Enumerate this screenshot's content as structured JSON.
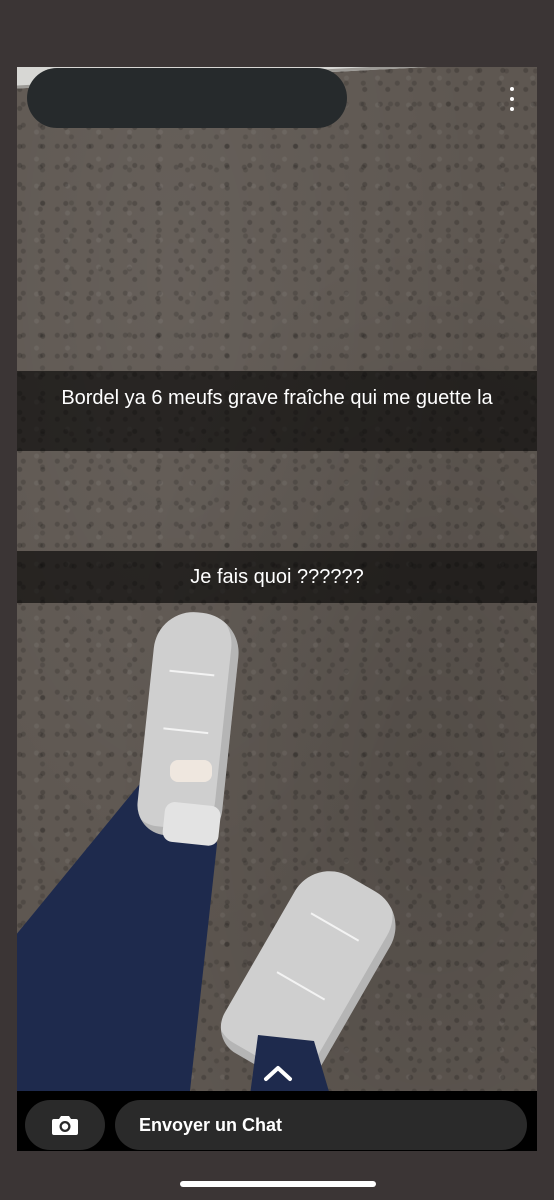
{
  "snap": {
    "captions": [
      "Bordel ya 6 meufs grave fraîche qui me guette la",
      "Je fais quoi ??????"
    ],
    "image_description_icon": "photo-of-feet-on-asphalt"
  },
  "header": {
    "redacted_name": "",
    "menu_icon": "vertical-dots-icon"
  },
  "footer": {
    "camera_icon": "camera-icon",
    "chat_placeholder": "Envoyer un Chat",
    "swipe_up_icon": "chevron-up-icon"
  },
  "colors": {
    "background": "#3b3535",
    "caption_bar": "rgba(0,0,0,0.6)",
    "redaction": "#262a2c",
    "bottom_bar": "#000000",
    "button_bg": "#2a2a2a",
    "text": "#ffffff"
  }
}
